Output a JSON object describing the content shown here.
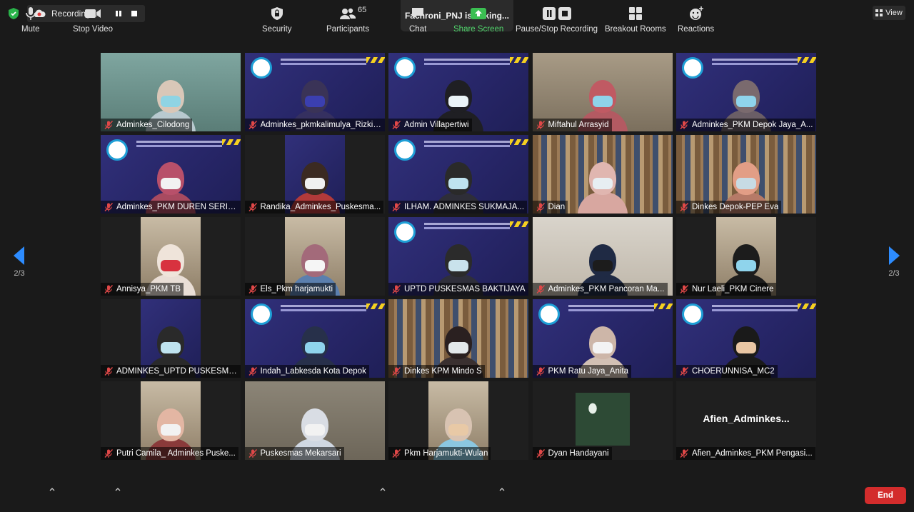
{
  "recording": {
    "label": "Recording..."
  },
  "talking_indicator": "Fachroni_PNJ is talking...",
  "view_button": {
    "label": "View"
  },
  "pagination": {
    "left": "2/3",
    "right": "2/3"
  },
  "participants": [
    {
      "name": "Adminkes_Cilodong",
      "scene": "teal",
      "head": "#d9c7b8",
      "mask": "#8fd4e4",
      "body": "#b8c9cf"
    },
    {
      "name": "Adminkes_pkmkalimulya_Rizki ...",
      "scene": "banner",
      "head": "#3a3357",
      "mask": "#3b3fb0",
      "body": "#353060"
    },
    {
      "name": "Admin Villapertiwi",
      "scene": "banner",
      "head": "#1f1f23",
      "mask": "#eaf3f7",
      "body": "#1f1f23"
    },
    {
      "name": "Miftahul Arrasyid",
      "scene": "office",
      "head": "#c05a63",
      "mask": "#8fd3ea",
      "body": "#b35a62"
    },
    {
      "name": "Adminkes_PKM Depok Jaya_A...",
      "scene": "banner",
      "head": "#7a6a6e",
      "mask": "#8fd4ec",
      "body": "#6a5e66"
    },
    {
      "name": "Adminkes_PKM DUREN SERIBU",
      "scene": "banner",
      "head": "#b8506a",
      "mask": "#f2f2f2",
      "body": "#a84a60"
    },
    {
      "name": "Randika_Adminkes_Puskesma...",
      "scene": "inset-banner",
      "head": "#3b2a22",
      "mask": "#f0f0f0",
      "body": "#b23a3a"
    },
    {
      "name": "ILHAM. ADMINKES SUKMAJA...",
      "scene": "banner",
      "head": "#2a2a2a",
      "mask": "#bfe3ef",
      "body": "#2e2e38"
    },
    {
      "name": "Dian",
      "scene": "shelf",
      "head": "#e0b6b0",
      "mask": "#e7eef2",
      "body": "#d8a7a0"
    },
    {
      "name": "Dinkes Depok-PEP Eva",
      "scene": "shelf",
      "head": "#e29e86",
      "mask": "#c7dbe4",
      "body": "#b67a67"
    },
    {
      "name": "Annisya_PKM TB",
      "scene": "inset-light",
      "head": "#efe4da",
      "mask": "#d8323f",
      "body": "#e9ded6"
    },
    {
      "name": "Els_Pkm harjamukti",
      "scene": "inset-light",
      "head": "#a36a7a",
      "mask": "#f5f5f5",
      "body": "#5b7fae"
    },
    {
      "name": "UPTD PUSKESMAS BAKTIJAYA",
      "scene": "banner",
      "head": "#2b2b2b",
      "mask": "#c9e2ec",
      "body": "#2f2f3a"
    },
    {
      "name": "Adminkes_PKM Pancoran Ma...",
      "scene": "light",
      "head": "#1f2a44",
      "mask": "#1c1c1c",
      "body": "#1f2a44"
    },
    {
      "name": "Nur Laeli_PKM Cinere",
      "scene": "inset-light",
      "head": "#1c1c1c",
      "mask": "#8fd4ec",
      "body": "#1c1c1c"
    },
    {
      "name": "ADMINKES_UPTD PUSKESMA...",
      "scene": "inset-banner",
      "head": "#2a2a2a",
      "mask": "#bfe3ef",
      "body": "#2a2a2a"
    },
    {
      "name": "Indah_Labkesda Kota Depok",
      "scene": "banner",
      "head": "#27304a",
      "mask": "#8fd4ec",
      "body": "#27304a"
    },
    {
      "name": "Dinkes KPM Mindo S",
      "scene": "shelf",
      "head": "#2a2020",
      "mask": "#e3e8ea",
      "body": "#3a3030"
    },
    {
      "name": "PKM Ratu Jaya_Anita",
      "scene": "banner",
      "head": "#cdb6a8",
      "mask": "#f3f3f3",
      "body": "#d2c0b4"
    },
    {
      "name": "CHOERUNNISA_MC2",
      "scene": "banner",
      "head": "#1a1a1a",
      "mask": "#e9c6a4",
      "body": "#1a1a1a"
    },
    {
      "name": "Putri Camila_ Adminkes Puske...",
      "scene": "inset-light",
      "head": "#e3b6a3",
      "mask": "#f2f2f2",
      "body": "#8a3a3a"
    },
    {
      "name": "Puskesmas Mekarsari",
      "scene": "room",
      "head": "#d9dde4",
      "mask": "#f2f2f2",
      "body": "#cfd7e2"
    },
    {
      "name": "Pkm Harjamukti-Wulan",
      "scene": "inset-light",
      "head": "#d8c3b2",
      "mask": "#e8c9a6",
      "body": "#8bc7e0"
    },
    {
      "name": "Dyan Handayani",
      "scene": "plant"
    },
    {
      "name": "Afien_Adminkes_PKM Pengasi...",
      "scene": "noVideo",
      "display": "Afien_Adminkes..."
    }
  ],
  "toolbar": {
    "mute": "Mute",
    "stop_video": "Stop Video",
    "security": "Security",
    "participants": "Participants",
    "participant_count": "65",
    "chat": "Chat",
    "share_screen": "Share Screen",
    "pause_stop_recording": "Pause/Stop Recording",
    "breakout_rooms": "Breakout Rooms",
    "reactions": "Reactions",
    "end": "End"
  },
  "colors": {
    "end_button": "#d32c2c",
    "share_green": "#4fd36a",
    "background": "#1a1a1a"
  }
}
